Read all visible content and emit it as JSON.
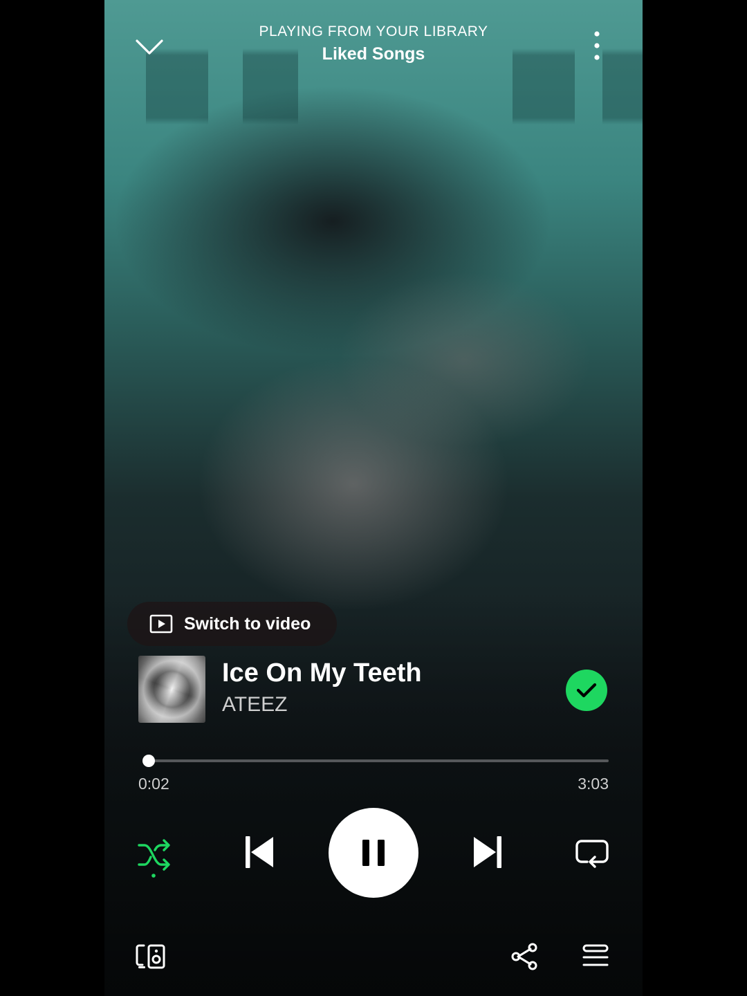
{
  "header": {
    "context_label": "PLAYING FROM YOUR LIBRARY",
    "title": "Liked Songs",
    "collapse_icon": "chevron-down-icon",
    "more_icon": "more-vertical-icon"
  },
  "video_toggle": {
    "label": "Switch to video",
    "icon": "play-video-icon"
  },
  "track": {
    "title": "Ice On My Teeth",
    "artist": "ATEEZ",
    "liked": true
  },
  "progress": {
    "elapsed": "0:02",
    "total": "3:03",
    "fraction": 0.011
  },
  "controls": {
    "shuffle_icon": "shuffle-icon",
    "shuffle_active": true,
    "previous_icon": "skip-previous-icon",
    "play_pause_icon": "pause-icon",
    "next_icon": "skip-next-icon",
    "repeat_icon": "repeat-icon"
  },
  "bottom_bar": {
    "devices_icon": "connect-devices-icon",
    "share_icon": "share-icon",
    "queue_icon": "queue-icon"
  },
  "colors": {
    "accent": "#1ed760",
    "text_secondary": "#cfcfcf"
  }
}
